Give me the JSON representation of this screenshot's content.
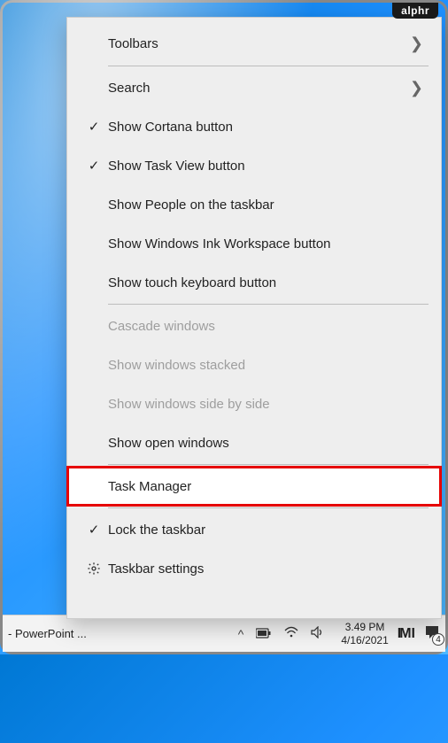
{
  "badge": "alphr",
  "menu": {
    "toolbars": "Toolbars",
    "search": "Search",
    "cortana": "Show Cortana button",
    "taskview": "Show Task View button",
    "people": "Show People on the taskbar",
    "ink": "Show Windows Ink Workspace button",
    "touchkb": "Show touch keyboard button",
    "cascade": "Cascade windows",
    "stacked": "Show windows stacked",
    "sidebyside": "Show windows side by side",
    "openwindows": "Show open windows",
    "taskmanager": "Task Manager",
    "lock": "Lock the taskbar",
    "settings": "Taskbar settings"
  },
  "taskbar": {
    "app": "- PowerPoint ...",
    "time": "3.49 PM",
    "date": "4/16/2021",
    "notif_count": "4"
  }
}
